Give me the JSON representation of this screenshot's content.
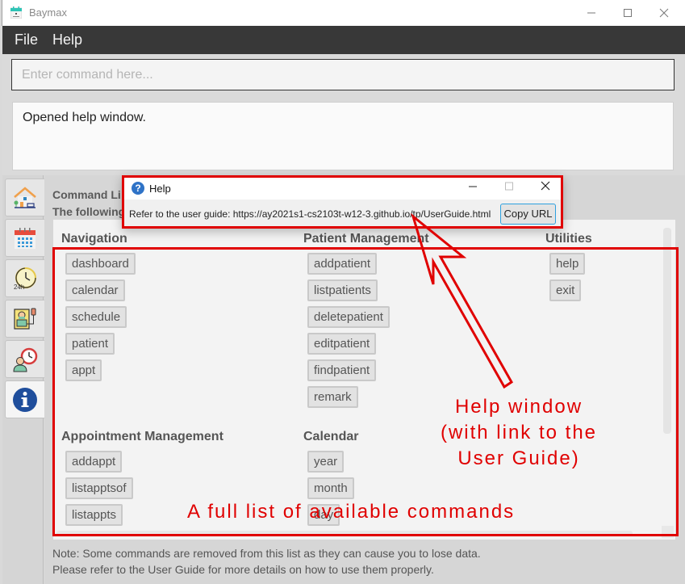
{
  "window": {
    "title": "Baymax",
    "icon": "calendar-app-icon",
    "controls": {
      "minimize": "–",
      "maximize": "☐",
      "close": "✕"
    }
  },
  "menu": {
    "items": [
      {
        "label": "File"
      },
      {
        "label": "Help"
      }
    ]
  },
  "command_box": {
    "placeholder": "Enter command here...",
    "value": ""
  },
  "result_box": {
    "text": "Opened help window."
  },
  "sidebar": {
    "tabs": [
      {
        "name": "dashboard",
        "icon": "house-icon",
        "active": false
      },
      {
        "name": "calendar",
        "icon": "calendar-icon",
        "active": false
      },
      {
        "name": "schedule",
        "icon": "clock-24h-icon",
        "active": false
      },
      {
        "name": "patient",
        "icon": "hospital-bed-patient-icon",
        "active": false
      },
      {
        "name": "appointment",
        "icon": "doctor-clock-icon",
        "active": false
      },
      {
        "name": "help",
        "icon": "info-icon",
        "active": true
      }
    ]
  },
  "main": {
    "header_line1": "Command Li",
    "header_line2": "The following",
    "sections": [
      {
        "title": "Navigation",
        "commands": [
          "dashboard",
          "calendar",
          "schedule",
          "patient",
          "appt"
        ]
      },
      {
        "title": "Patient Management",
        "commands": [
          "addpatient",
          "listpatients",
          "deletepatient",
          "editpatient",
          "findpatient",
          "remark"
        ]
      },
      {
        "title": "Utilities",
        "commands": [
          "help",
          "exit"
        ]
      },
      {
        "title": "Appointment Management",
        "commands": [
          "addappt",
          "listapptsof",
          "listappts"
        ]
      },
      {
        "title": "Calendar",
        "commands": [
          "year",
          "month",
          "day"
        ]
      }
    ],
    "note_line1": "Note: Some commands are removed from this list as they can cause you to lose data.",
    "note_line2": "Please refer to the User Guide for more details on how to use them properly."
  },
  "help_dialog": {
    "title": "Help",
    "icon": "question-icon",
    "message": "Refer to the user guide: https://ay2021s1-cs2103t-w12-3.github.io/tp/UserGuide.html",
    "copy_button": "Copy URL",
    "controls": {
      "minimize": "—",
      "maximize": "☐",
      "close": "✕"
    }
  },
  "annotations": {
    "help_window_label": "Help window\n(with link to the\nUser Guide)",
    "help_window_lines": [
      "Help window",
      "(with link to the",
      "User Guide)"
    ],
    "command_list_label": "A full list of available commands",
    "color": "#e00000"
  }
}
